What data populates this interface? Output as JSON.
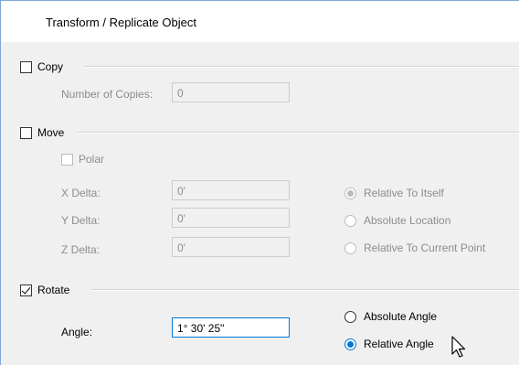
{
  "window": {
    "title": "Transform / Replicate Object"
  },
  "copy": {
    "label": "Copy",
    "checked": false,
    "number_of_copies_label": "Number of Copies:",
    "number_of_copies_value": "0"
  },
  "move": {
    "label": "Move",
    "checked": false,
    "polar_label": "Polar",
    "x_delta_label": "X Delta:",
    "x_delta_value": "0'",
    "y_delta_label": "Y Delta:",
    "y_delta_value": "0'",
    "z_delta_label": "Z Delta:",
    "z_delta_value": "0'",
    "options": [
      {
        "label": "Relative To Itself",
        "selected": true
      },
      {
        "label": "Absolute Location",
        "selected": false
      },
      {
        "label": "Relative To Current Point",
        "selected": false
      }
    ]
  },
  "rotate": {
    "label": "Rotate",
    "checked": true,
    "angle_label": "Angle:",
    "angle_value": "1° 30' 25\"",
    "options": [
      {
        "label": "Absolute Angle",
        "selected": false
      },
      {
        "label": "Relative Angle",
        "selected": true
      }
    ]
  },
  "colors": {
    "accent": "#0078d7",
    "disabled_text": "#8d8d8d"
  },
  "icons": {
    "cursor": "mouse-pointer-icon"
  }
}
